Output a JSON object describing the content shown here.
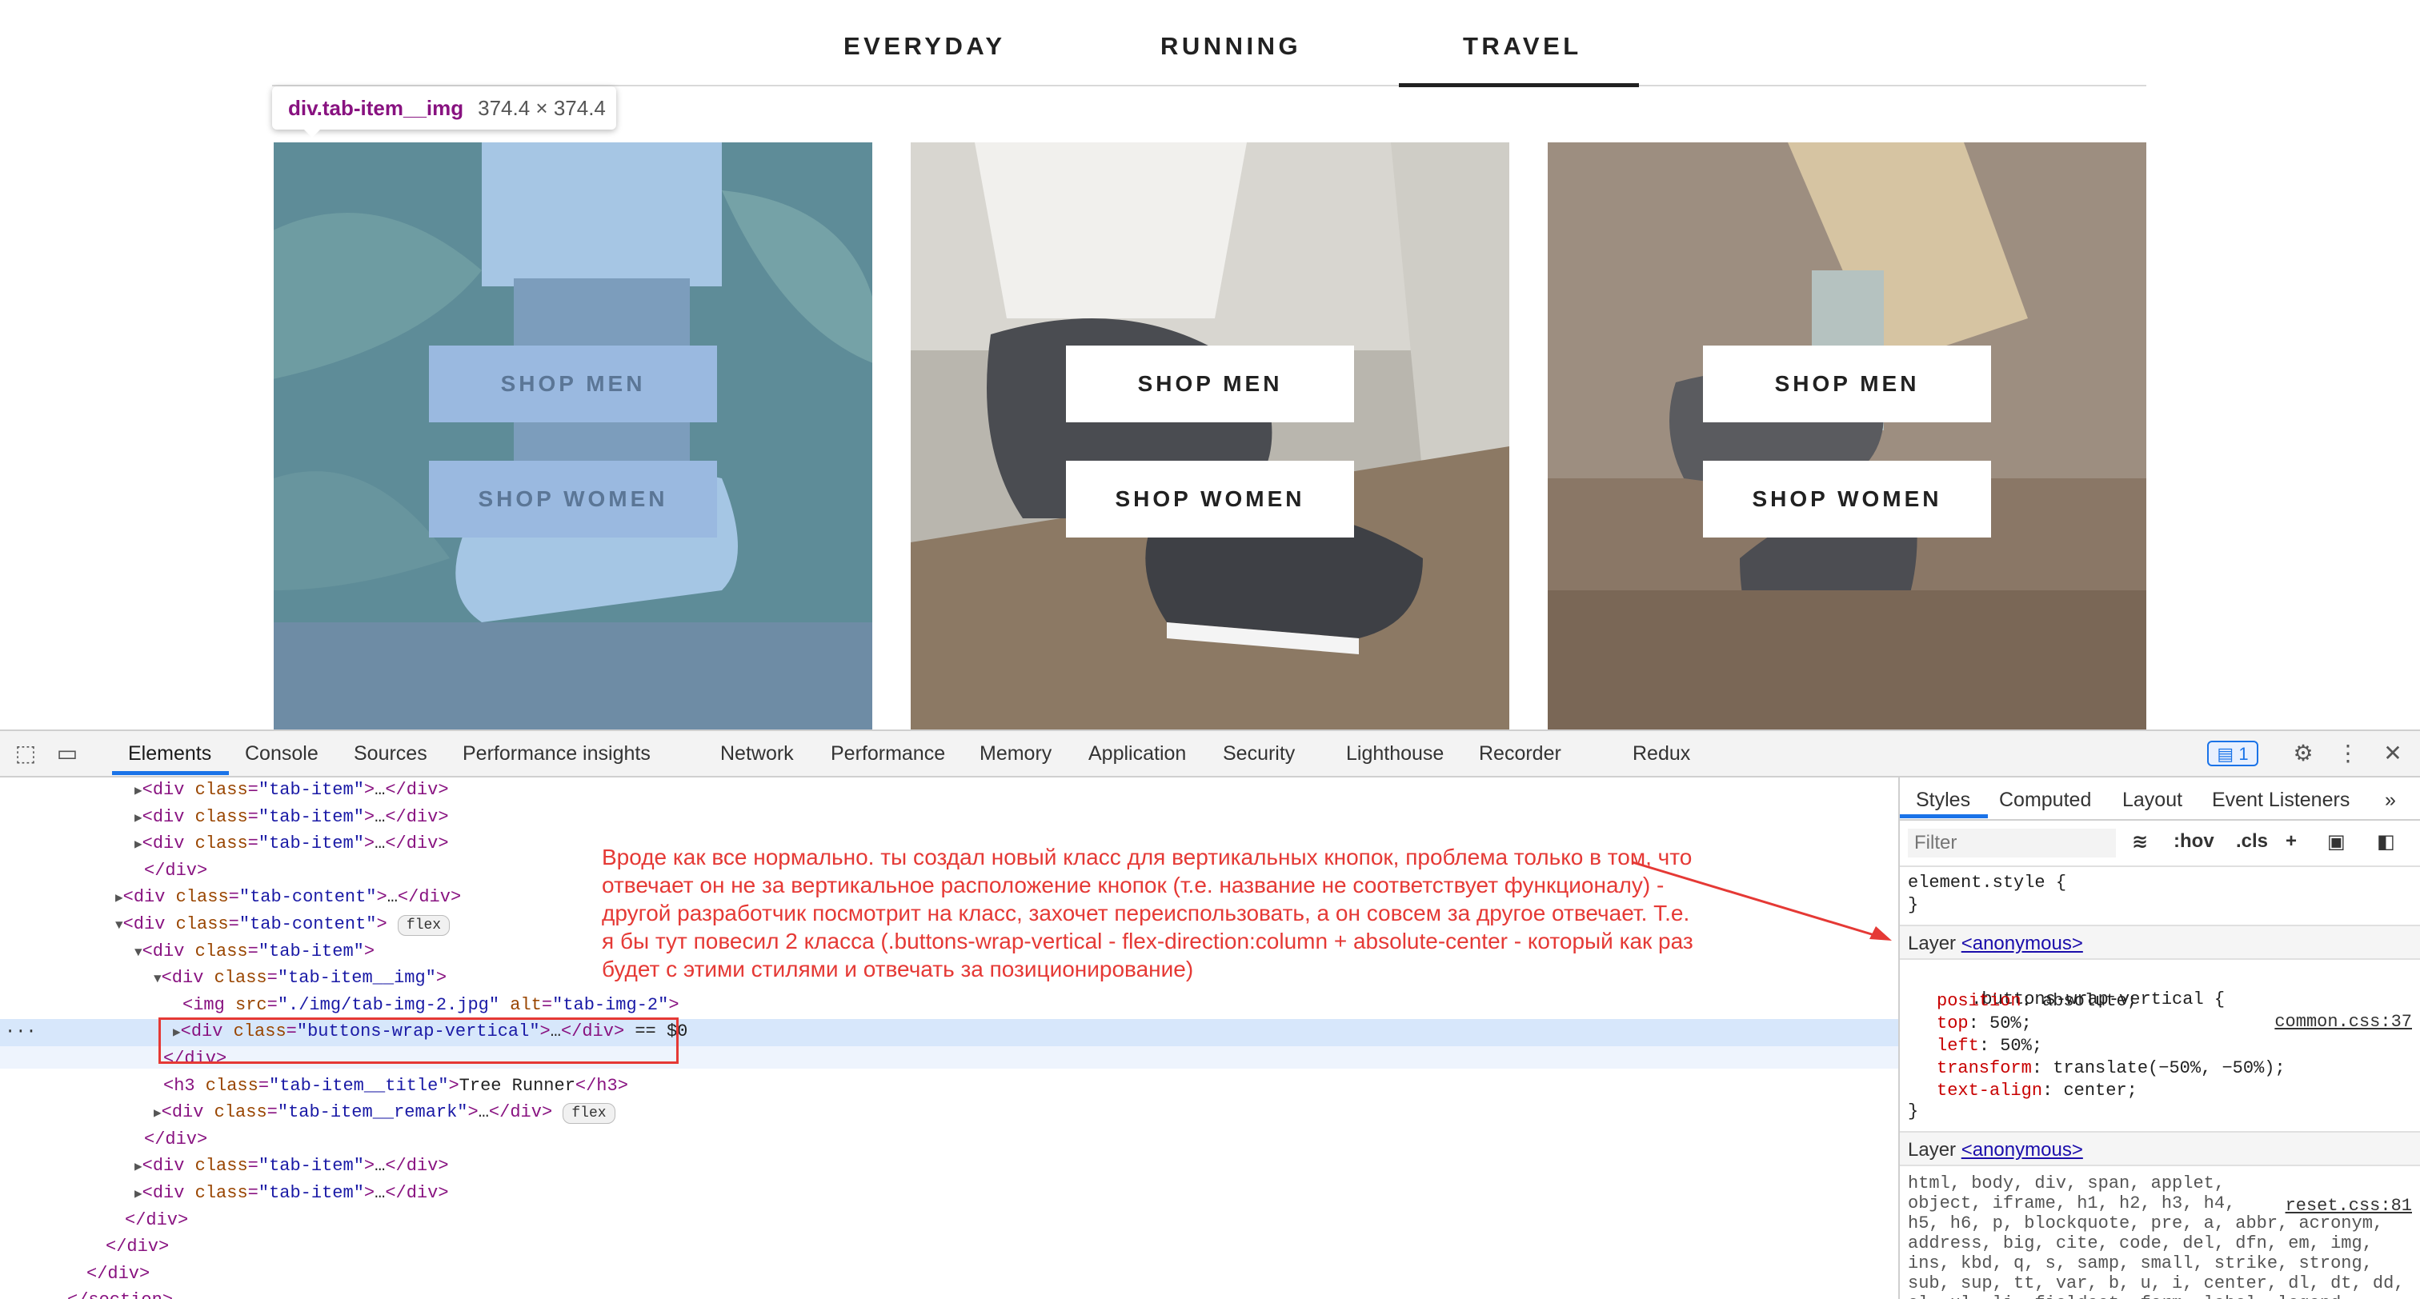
{
  "page": {
    "tabs": [
      "EVERYDAY",
      "RUNNING",
      "TRAVEL"
    ],
    "active_tab": "TRAVEL",
    "tooltip": {
      "selector": "div.tab-item__img",
      "size": "374.4 × 374.4"
    },
    "cards": [
      {
        "shop_men": "SHOP MEN",
        "shop_women": "SHOP WOMEN"
      },
      {
        "shop_men": "SHOP MEN",
        "shop_women": "SHOP WOMEN"
      },
      {
        "shop_men": "SHOP MEN",
        "shop_women": "SHOP WOMEN"
      }
    ]
  },
  "devtools": {
    "tabs": [
      "Elements",
      "Console",
      "Sources",
      "Performance insights",
      "Network",
      "Performance",
      "Memory",
      "Application",
      "Security",
      "Lighthouse",
      "Recorder",
      "Redux"
    ],
    "active_tab": "Elements",
    "issues_count": "1",
    "dom_lines": [
      {
        "indent": 7,
        "arrow": "▶",
        "html": "<div class=\"tab-item\">…</div>"
      },
      {
        "indent": 7,
        "arrow": "▶",
        "html": "<div class=\"tab-item\">…</div>"
      },
      {
        "indent": 7,
        "arrow": "▶",
        "html": "<div class=\"tab-item\">…</div>"
      },
      {
        "indent": 7,
        "arrow": "",
        "html": "</div>"
      },
      {
        "indent": 6,
        "arrow": "▶",
        "html": "<div class=\"tab-content\">…</div>"
      },
      {
        "indent": 6,
        "arrow": "▼",
        "html": "<div class=\"tab-content\">",
        "badge": "flex"
      },
      {
        "indent": 7,
        "arrow": "▼",
        "html": "<div class=\"tab-item\">"
      },
      {
        "indent": 8,
        "arrow": "▼",
        "html": "<div class=\"tab-item__img\">"
      },
      {
        "indent": 9,
        "arrow": "",
        "html": "<img src=\"./img/tab-img-2.jpg\" alt=\"tab-img-2\">"
      },
      {
        "indent": 9,
        "arrow": "▶",
        "html": "<div class=\"buttons-wrap-vertical\">…</div> == $0"
      },
      {
        "indent": 8,
        "arrow": "",
        "html": "</div>"
      },
      {
        "indent": 8,
        "arrow": "",
        "html": "<h3 class=\"tab-item__title\">Tree Runner</h3>"
      },
      {
        "indent": 8,
        "arrow": "▶",
        "html": "<div class=\"tab-item__remark\">…</div>",
        "badge": "flex"
      },
      {
        "indent": 7,
        "arrow": "",
        "html": "</div>"
      },
      {
        "indent": 7,
        "arrow": "▶",
        "html": "<div class=\"tab-item\">…</div>"
      },
      {
        "indent": 7,
        "arrow": "▶",
        "html": "<div class=\"tab-item\">…</div>"
      },
      {
        "indent": 6,
        "arrow": "",
        "html": "</div>"
      },
      {
        "indent": 5,
        "arrow": "",
        "html": "</div>"
      },
      {
        "indent": 4,
        "arrow": "",
        "html": "</div>"
      },
      {
        "indent": 3,
        "arrow": "",
        "html": "</section>"
      }
    ],
    "note": "Вроде как все нормально. ты создал новый класс для вертикальных кнопок, проблема только в том, что отвечает он не за вертикальное расположение кнопок (т.е. название не соответствует функционалу) - другой разработчик посмотрит на класс, захочет переиспользовать, а он совсем за другое отвечает.  Т.е. я бы тут повесил 2 класса (.buttons-wrap-vertical  - flex-direction:column + absolute-center - который как раз будет с этими стилями и отвечать за позиционирование)",
    "styles": {
      "tabs": [
        "Styles",
        "Computed",
        "Layout",
        "Event Listeners"
      ],
      "filter_placeholder": "Filter",
      "hov": ":hov",
      "cls": ".cls",
      "element_style": "element.style {",
      "close_brace": "}",
      "layer_label": "Layer",
      "layer_link": "<anonymous>",
      "rule_selector": ".buttons-wrap-vertical {",
      "rule_source": "common.css:37",
      "declarations": [
        {
          "prop": "position",
          "value": "absolute;"
        },
        {
          "prop": "top",
          "value": "50%;"
        },
        {
          "prop": "left",
          "value": "50%;"
        },
        {
          "prop": "transform",
          "value": "translate(−50%, −50%);"
        },
        {
          "prop": "text-align",
          "value": "center;"
        }
      ],
      "reset_source": "reset.css:81",
      "reset_selector_lines": [
        "html, body, div, span, applet,",
        "object, iframe, h1, h2, h3, h4,",
        "h5, h6, p, blockquote, pre, a, abbr, acronym,",
        "address, big, cite, code, del, dfn, em, img,",
        "ins, kbd, q, s, samp, small, strike, strong,",
        "sub, sup, tt, var, b, u, i, center, dl, dt, dd,",
        "ol, ul, li, fieldset, form, label, legend,"
      ]
    }
  }
}
